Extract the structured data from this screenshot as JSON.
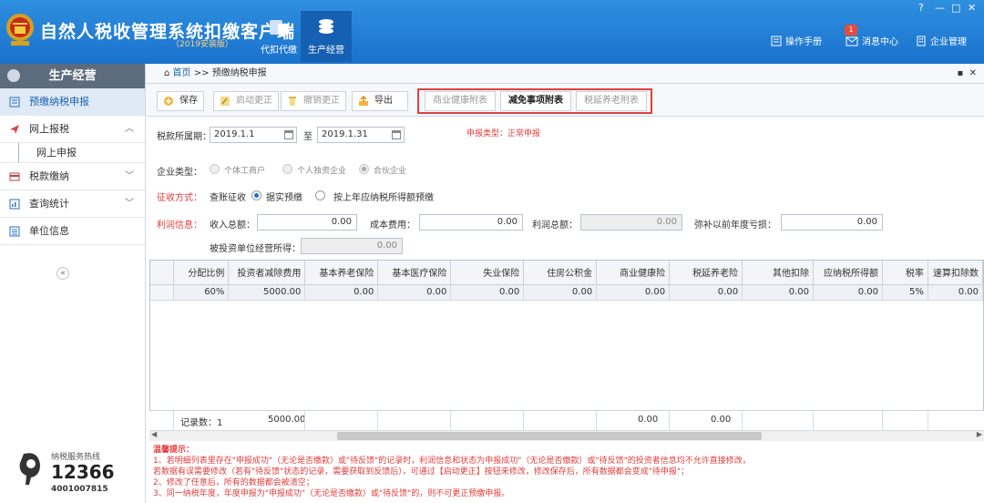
{
  "app": {
    "title": "自然人税收管理系统扣缴客户端",
    "version": "（2019安装版）",
    "nav": [
      "代扣代缴",
      "生产经营"
    ],
    "header_links": [
      "操作手册",
      "消息中心",
      "企业管理"
    ],
    "badge_count": "1"
  },
  "window": {
    "help": "?",
    "min": "—",
    "restore": "□",
    "close": "✕"
  },
  "sidebar": {
    "title": "生产经营",
    "items": [
      "预缴纳税申报",
      "网上报税",
      "网上申报",
      "税款缴纳",
      "查询统计",
      "单位信息"
    ],
    "collapse": "«"
  },
  "hotline": {
    "label": "纳税服务热线",
    "number": "12366",
    "sub": "4001007815"
  },
  "breadcrumb": {
    "home": "首页",
    "sep": ">>",
    "current": "预缴纳税申报"
  },
  "toolbar": {
    "save": "保存",
    "start_correct": "启动更正",
    "cancel_correct": "撤销更正",
    "export": "导出",
    "attachments": [
      "商业健康附表",
      "减免事项附表",
      "税延养老附表"
    ]
  },
  "form": {
    "period_label": "税款所属期：",
    "period_from": "2019.1.1",
    "period_to_label": "至",
    "period_to": "2019.1.31",
    "decl_type": "申报类型：正常申报",
    "company_type_label": "企业类型：",
    "company_types": [
      "个体工商户",
      "个人独资企业",
      "合伙企业"
    ],
    "levy_label": "征收方式：",
    "levy_options": [
      "查账征收",
      "据实预缴",
      "按上年应纳税所得额预缴"
    ],
    "profit_label": "利润信息：",
    "income_label": "收入总额：",
    "income_value": "0.00",
    "cost_label": "成本费用：",
    "cost_value": "0.00",
    "profit_total_label": "利润总额：",
    "profit_total_value": "0.00",
    "loss_label": "弥补以前年度亏损：",
    "loss_value": "0.00",
    "invested_label": "被投资单位经营所得：",
    "invested_value": "0.00"
  },
  "grid": {
    "headers": [
      "分配比例",
      "投资者减除费用",
      "基本养老保险",
      "基本医疗保险",
      "失业保险",
      "住房公积金",
      "商业健康险",
      "税延养老险",
      "其他扣除",
      "应纳税所得额",
      "税率",
      "速算扣除数"
    ],
    "row": [
      "60%",
      "5000.00",
      "0.00",
      "0.00",
      "0.00",
      "0.00",
      "0.00",
      "0.00",
      "0.00",
      "0.00",
      "5%",
      "0.00"
    ],
    "footer": {
      "count": "记录数：1",
      "deduction": "5000.00",
      "commercial": "0.00",
      "pension": "0.00"
    }
  },
  "tips": {
    "title": "温馨提示：",
    "lines": [
      "1、若明细列表里存在\"申报成功\"（无论是否缴款）或\"待反馈\"的记录时，利润信息和状态为申报成功\"（无论是否缴款）或\"待反馈\"的投资者信息均不允许直接修改，",
      "    若数据有误需要修改（若有\"待反馈\"状态的记录，需要获取到反馈后），可通过【启动更正】按钮来修改，修改保存后，所有数据都会变成\"待申报\"；",
      "2、修改了任意后，所有的数据都会被清空；",
      "3、同一纳税年度，年度申报为\"申报成功\"（无论是否缴款）或\"待反馈\"的，则不可更正预缴申报。"
    ]
  }
}
